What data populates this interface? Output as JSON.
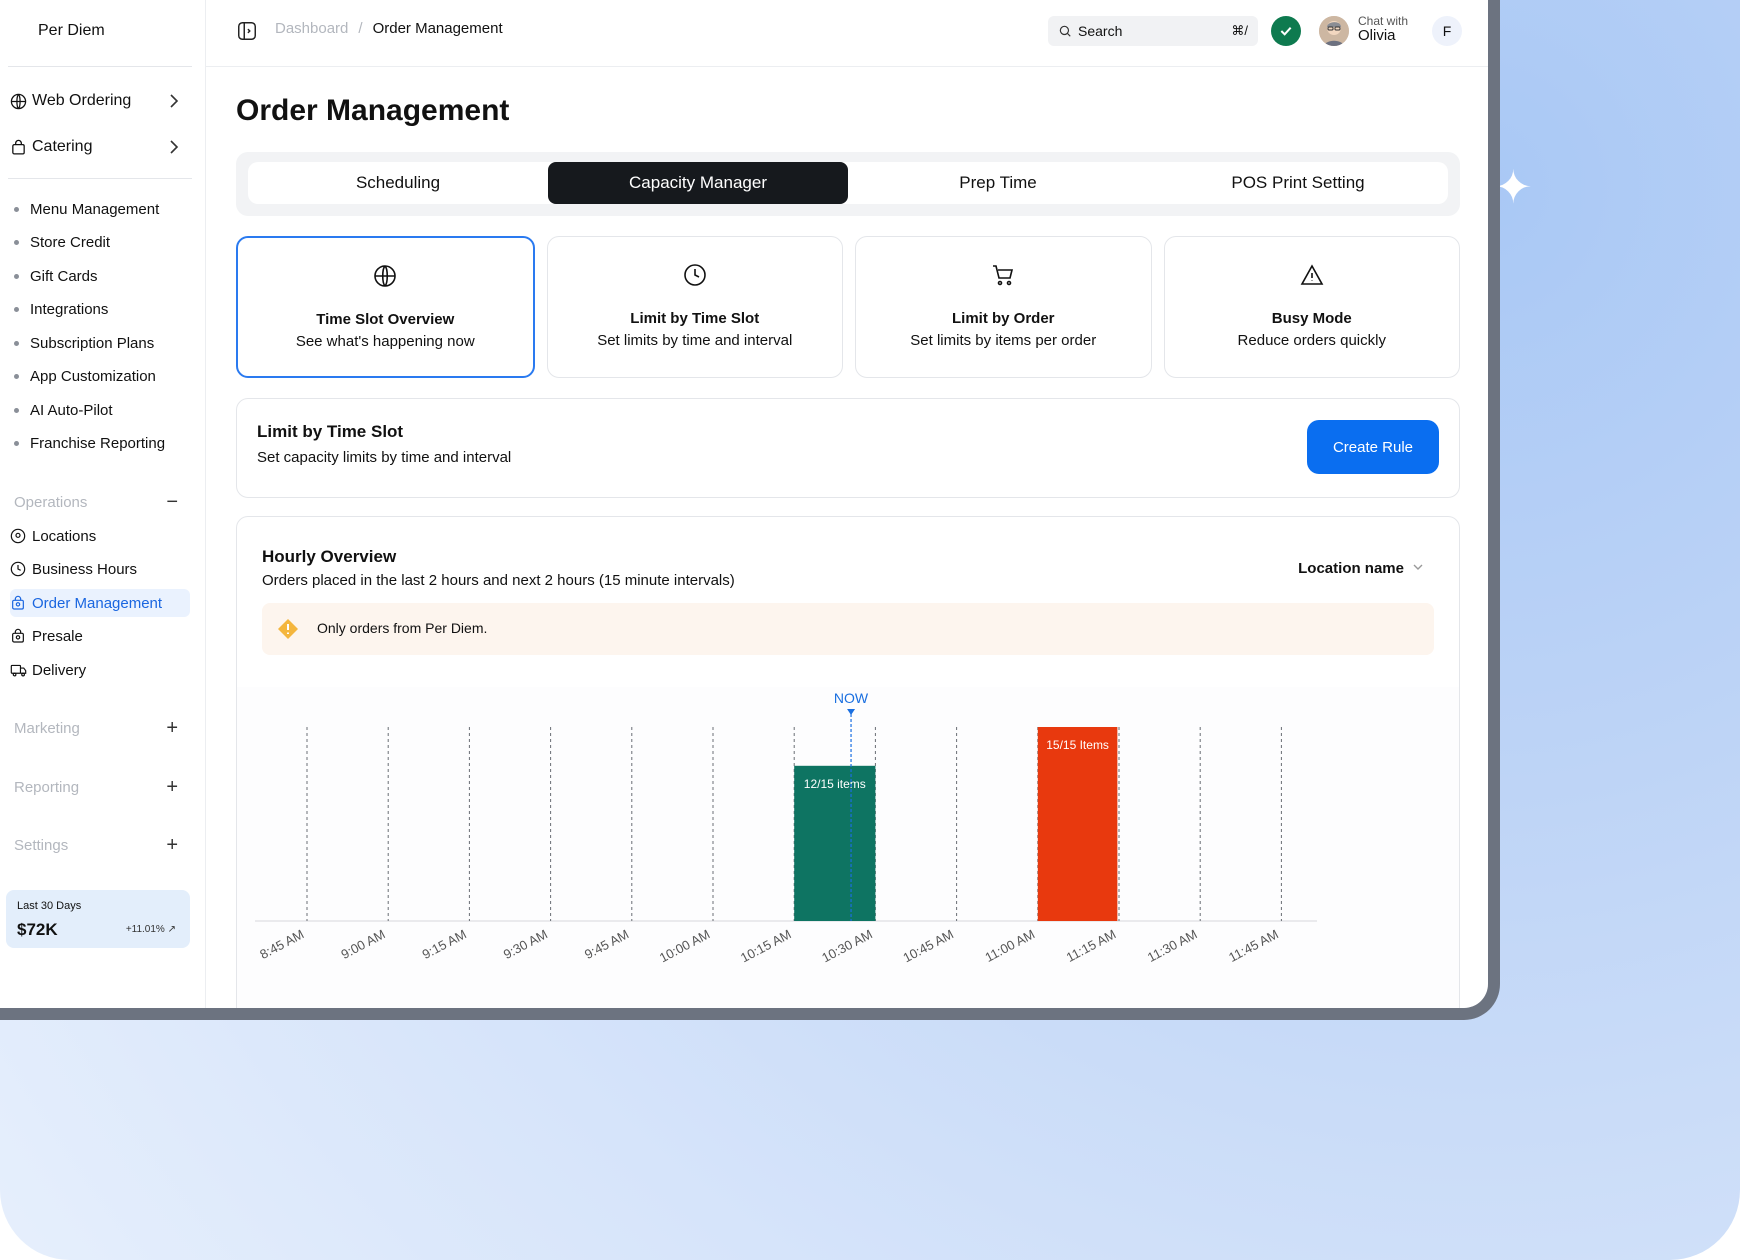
{
  "brand": {
    "name": "Per Diem"
  },
  "sidebar": {
    "top_items": [
      {
        "label": "Web Ordering"
      },
      {
        "label": "Catering"
      }
    ],
    "menu_items": [
      "Menu Management",
      "Store Credit",
      "Gift Cards",
      "Integrations",
      "Subscription Plans",
      "App Customization",
      "AI Auto-Pilot",
      "Franchise Reporting"
    ],
    "operations": {
      "heading": "Operations",
      "items": [
        "Locations",
        "Business Hours",
        "Order Management",
        "Presale",
        "Delivery"
      ]
    },
    "marketing_heading": "Marketing",
    "reporting_heading": "Reporting",
    "settings_heading": "Settings",
    "stats": {
      "label": "Last 30 Days",
      "value": "$72K",
      "change": "+11.01%"
    }
  },
  "topbar": {
    "breadcrumb": {
      "parent": "Dashboard",
      "separator": "/",
      "current": "Order Management"
    },
    "search": {
      "label": "Search",
      "shortcut": "⌘/"
    },
    "chat": {
      "prefix": "Chat with",
      "name": "Olivia"
    },
    "user_initial": "F"
  },
  "page": {
    "title": "Order Management"
  },
  "tabs": [
    {
      "label": "Scheduling",
      "active": false
    },
    {
      "label": "Capacity Manager",
      "active": true
    },
    {
      "label": "Prep Time",
      "active": false
    },
    {
      "label": "POS Print Setting",
      "active": false
    }
  ],
  "cards": [
    {
      "icon": "globe-icon",
      "title": "Time Slot Overview",
      "desc": "See what's happening now",
      "selected": true
    },
    {
      "icon": "clock-icon",
      "title": "Limit by Time Slot",
      "desc": "Set limits by time and interval",
      "selected": false
    },
    {
      "icon": "cart-icon",
      "title": "Limit by Order",
      "desc": "Set limits by items per order",
      "selected": false
    },
    {
      "icon": "warning-icon",
      "title": "Busy Mode",
      "desc": "Reduce orders quickly",
      "selected": false
    }
  ],
  "rule": {
    "title": "Limit by Time Slot",
    "desc": "Set capacity limits by time and interval",
    "button": "Create Rule"
  },
  "overview": {
    "title": "Hourly Overview",
    "desc": "Orders placed in the last 2 hours and next 2 hours (15 minute intervals)",
    "location_label": "Location name",
    "alert": "Only orders from Per Diem."
  },
  "colors": {
    "accent": "#0a6ef0",
    "ok": "#0e7a4f",
    "bar_under": "#0e7462",
    "bar_full": "#e8390e"
  },
  "chart_data": {
    "type": "bar",
    "categories": [
      "8:45 AM",
      "9:00 AM",
      "9:15 AM",
      "9:30 AM",
      "9:45 AM",
      "10:00 AM",
      "10:15 AM",
      "10:30 AM",
      "10:45 AM",
      "11:00 AM",
      "11:15 AM",
      "11:30 AM",
      "11:45 AM"
    ],
    "values": [
      0,
      0,
      0,
      0,
      0,
      0,
      12,
      0,
      0,
      15,
      0,
      0,
      0
    ],
    "capacity": 15,
    "labels": {
      "6": "12/15 items",
      "9": "15/15 Items"
    },
    "now_label": "NOW",
    "now_position": 6.7,
    "grid": true
  }
}
